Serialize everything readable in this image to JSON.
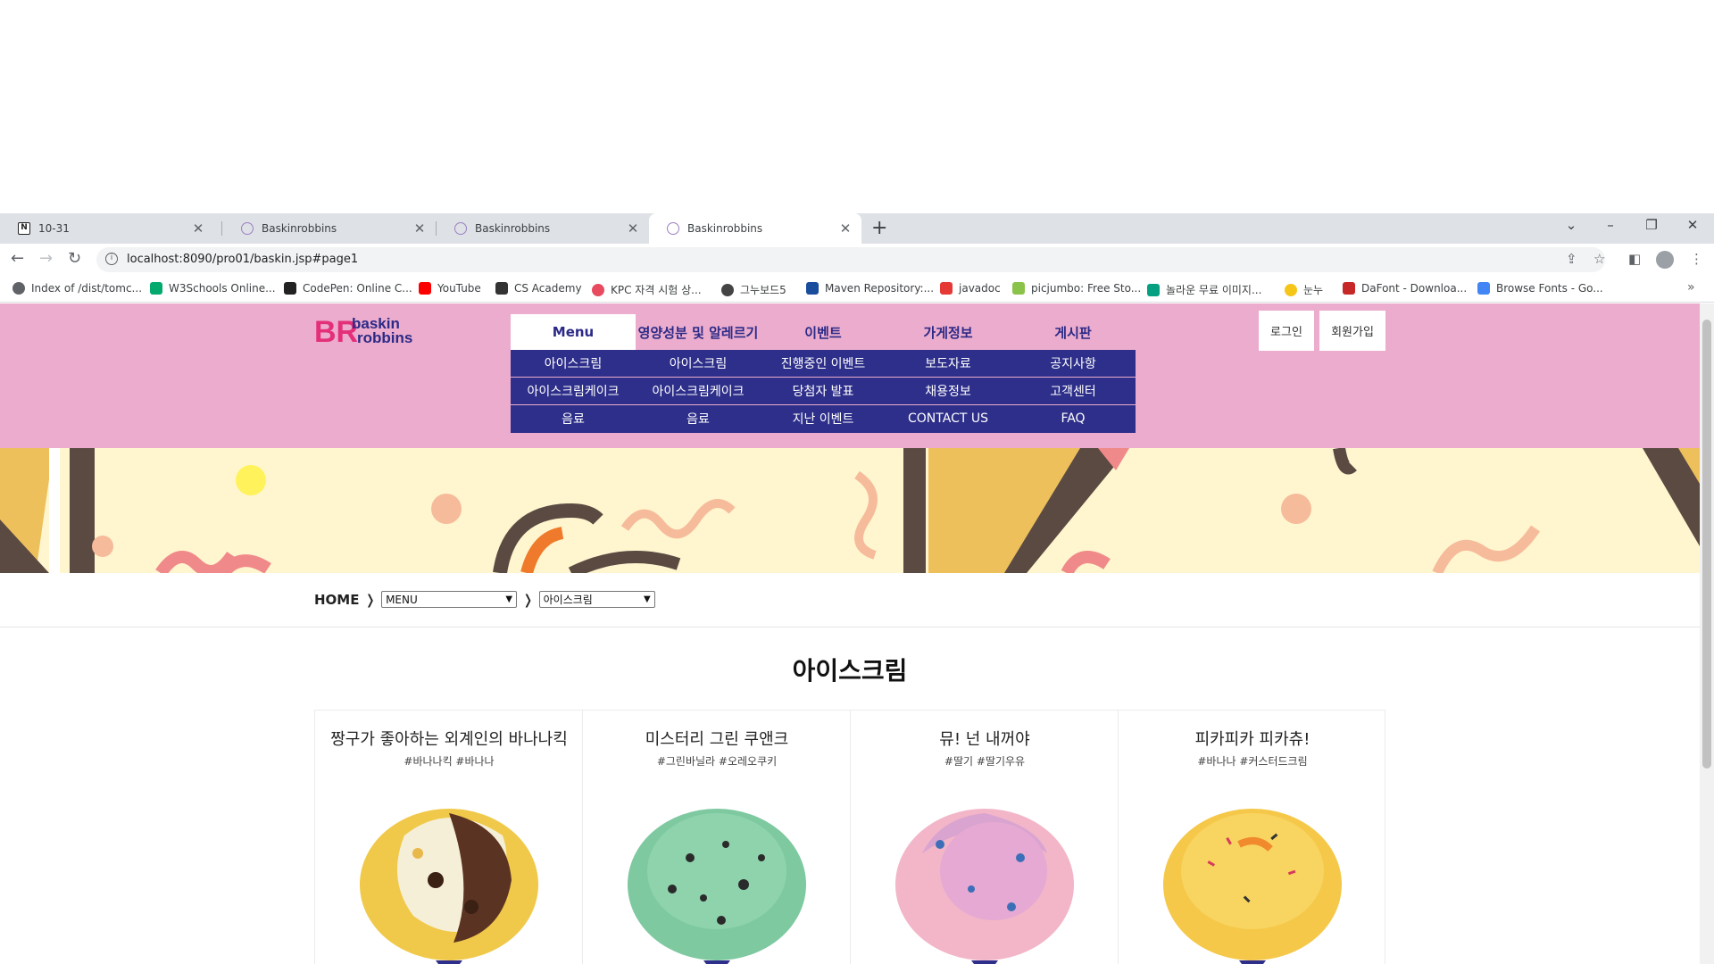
{
  "browser": {
    "tabs": [
      {
        "title": "10-31",
        "active": false
      },
      {
        "title": "Baskinrobbins",
        "active": false
      },
      {
        "title": "Baskinrobbins",
        "active": false
      },
      {
        "title": "Baskinrobbins",
        "active": true
      }
    ],
    "new_tab": "+",
    "url": "localhost:8090/pro01/baskin.jsp#page1",
    "bookmarks": [
      {
        "label": "Index of /dist/tomc...",
        "color": "#5f6368"
      },
      {
        "label": "W3Schools Online...",
        "color": "#04aa6d"
      },
      {
        "label": "CodePen: Online C...",
        "color": "#222222"
      },
      {
        "label": "YouTube",
        "color": "#ff0000"
      },
      {
        "label": "CS Academy",
        "color": "#333333"
      },
      {
        "label": "KPC 자격 시험 상...",
        "color": "#e84a5f"
      },
      {
        "label": "그누보드5",
        "color": "#444444"
      },
      {
        "label": "Maven Repository:...",
        "color": "#1a4d9c"
      },
      {
        "label": "javadoc",
        "color": "#e53935"
      },
      {
        "label": "picjumbo: Free Sto...",
        "color": "#8bc34a"
      },
      {
        "label": "놀라운 무료 이미지...",
        "color": "#05a081"
      },
      {
        "label": "눈누",
        "color": "#f5c518"
      },
      {
        "label": "DaFont - Downloa...",
        "color": "#c62828"
      },
      {
        "label": "Browse Fonts - Go...",
        "color": "#4285f4"
      }
    ]
  },
  "brand": {
    "logo_top": "baskin",
    "logo_bottom": "robbins",
    "logo_mark": "BR",
    "header_bg": "#ebaccd",
    "nav_color": "#2c2a87",
    "submenu_bg": "#2e2f8a"
  },
  "nav": {
    "top": [
      "Menu",
      "영양성분 및 알레르기",
      "이벤트",
      "가게정보",
      "게시판"
    ],
    "columns": [
      [
        "아이스크림",
        "아이스크림케이크",
        "음료"
      ],
      [
        "아이스크림",
        "아이스크림케이크",
        "음료"
      ],
      [
        "진행중인 이벤트",
        "당첨자 발표",
        "지난 이벤트"
      ],
      [
        "보도자료",
        "채용정보",
        "CONTACT US"
      ],
      [
        "공지사항",
        "고객센터",
        "FAQ"
      ]
    ]
  },
  "auth": {
    "login": "로그인",
    "signup": "회원가입"
  },
  "breadcrumb": {
    "home": "HOME",
    "arrow": "❭",
    "select1": "MENU",
    "select2": "아이스크림"
  },
  "page_title": "아이스크림",
  "products": [
    {
      "name": "짱구가 좋아하는 외계인의 바나나킥",
      "tags": "#바나나킥 #바나나",
      "flavor": "banana-choco"
    },
    {
      "name": "미스터리 그린 쿠앤크",
      "tags": "#그린바닐라 #오레오쿠키",
      "flavor": "mint-cookie"
    },
    {
      "name": "뮤! 넌 내꺼야",
      "tags": "#딸기 #딸기우유",
      "flavor": "strawberry"
    },
    {
      "name": "피카피카 피카츄!",
      "tags": "#바나나 #커스터드크림",
      "flavor": "custard"
    }
  ]
}
